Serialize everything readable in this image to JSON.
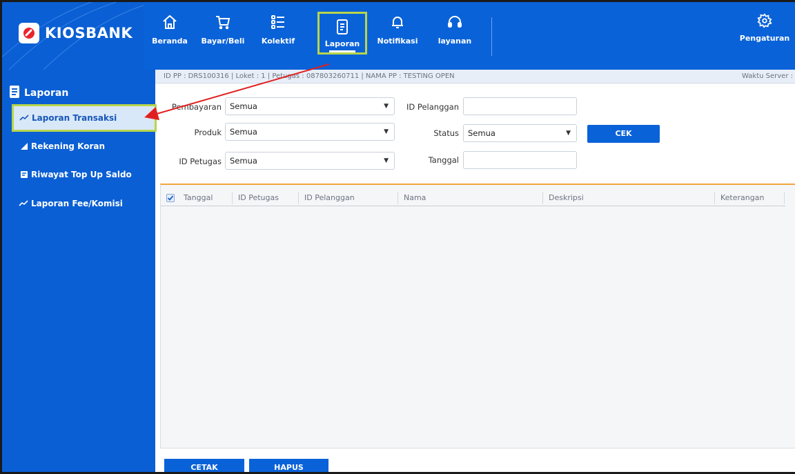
{
  "brand": {
    "name": "KIOSBANK"
  },
  "nav": {
    "items": [
      {
        "label": "Beranda",
        "icon": "home-icon"
      },
      {
        "label": "Bayar/Beli",
        "icon": "cart-icon"
      },
      {
        "label": "Kolektif",
        "icon": "list-icon"
      },
      {
        "label": "Laporan",
        "icon": "report-icon",
        "active": true
      },
      {
        "label": "Notifikasi",
        "icon": "bell-icon"
      },
      {
        "label": "layanan",
        "icon": "headset-icon"
      }
    ],
    "settings_label": "Pengaturan"
  },
  "sidebar": {
    "heading": "Laporan",
    "items": [
      {
        "label": "Laporan Transaksi",
        "icon": "trend-icon",
        "active": true
      },
      {
        "label": "Rekening Koran",
        "icon": "chart-up-icon"
      },
      {
        "label": "Riwayat Top Up Saldo",
        "icon": "topup-icon"
      },
      {
        "label": "Laporan Fee/Komisi",
        "icon": "trend-icon"
      }
    ]
  },
  "infobar": {
    "text": "ID PP : DRS100316 | Loket : 1 | Petugas : 087803260711 | NAMA PP : TESTING OPEN",
    "server_label": "Waktu Server :"
  },
  "form": {
    "pembayaran": {
      "label": "Pembayaran",
      "value": "Semua"
    },
    "produk": {
      "label": "Produk",
      "value": "Semua"
    },
    "id_petugas": {
      "label": "ID Petugas",
      "value": "Semua"
    },
    "id_pelanggan": {
      "label": "ID Pelanggan",
      "value": ""
    },
    "status": {
      "label": "Status",
      "value": "Semua"
    },
    "tanggal": {
      "label": "Tanggal",
      "value": ""
    },
    "cek_label": "CEK"
  },
  "table": {
    "columns": [
      "Tanggal",
      "ID Petugas",
      "ID Pelanggan",
      "Nama",
      "Deskripsi",
      "Keterangan"
    ]
  },
  "actions": {
    "cetak_label": "CETAK",
    "hapus_label": "HAPUS"
  },
  "colors": {
    "primary": "#0a62d8",
    "highlight": "#b9d54a",
    "annotation_arrow": "#e02020"
  }
}
